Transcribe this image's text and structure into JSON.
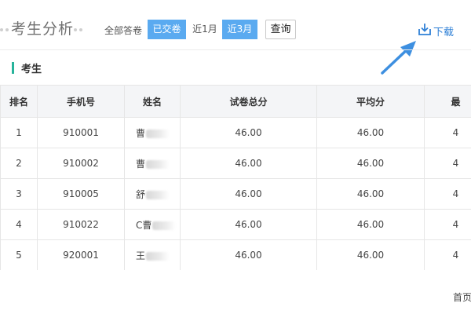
{
  "header": {
    "title": "考生分析",
    "filter_label": "全部答卷",
    "filters": [
      {
        "label": "已交卷",
        "active": true
      },
      {
        "label": "近1月",
        "active": false
      },
      {
        "label": "近3月",
        "active": true
      }
    ],
    "query_label": "查询",
    "download_label": "下载",
    "download_icon": "download-icon"
  },
  "section": {
    "title": "考生"
  },
  "table": {
    "columns": [
      "排名",
      "手机号",
      "姓名",
      "试卷总分",
      "平均分",
      "最"
    ],
    "rows": [
      {
        "rank": "1",
        "phone": "910001",
        "name": "曹",
        "total": "46.00",
        "avg": "46.00",
        "last": "4"
      },
      {
        "rank": "2",
        "phone": "910002",
        "name": "曹",
        "total": "46.00",
        "avg": "46.00",
        "last": "4"
      },
      {
        "rank": "3",
        "phone": "910005",
        "name": "舒",
        "total": "46.00",
        "avg": "46.00",
        "last": "4"
      },
      {
        "rank": "4",
        "phone": "910022",
        "name": "C曹",
        "total": "46.00",
        "avg": "46.00",
        "last": "4"
      },
      {
        "rank": "5",
        "phone": "920001",
        "name": "王",
        "total": "46.00",
        "avg": "46.00",
        "last": "4"
      }
    ]
  },
  "pagination": {
    "first_label": "首页"
  },
  "colors": {
    "accent": "#5aaaf0",
    "link": "#2f80d6",
    "section_bar": "#27b39b",
    "header_bg": "#f4f5f7"
  }
}
